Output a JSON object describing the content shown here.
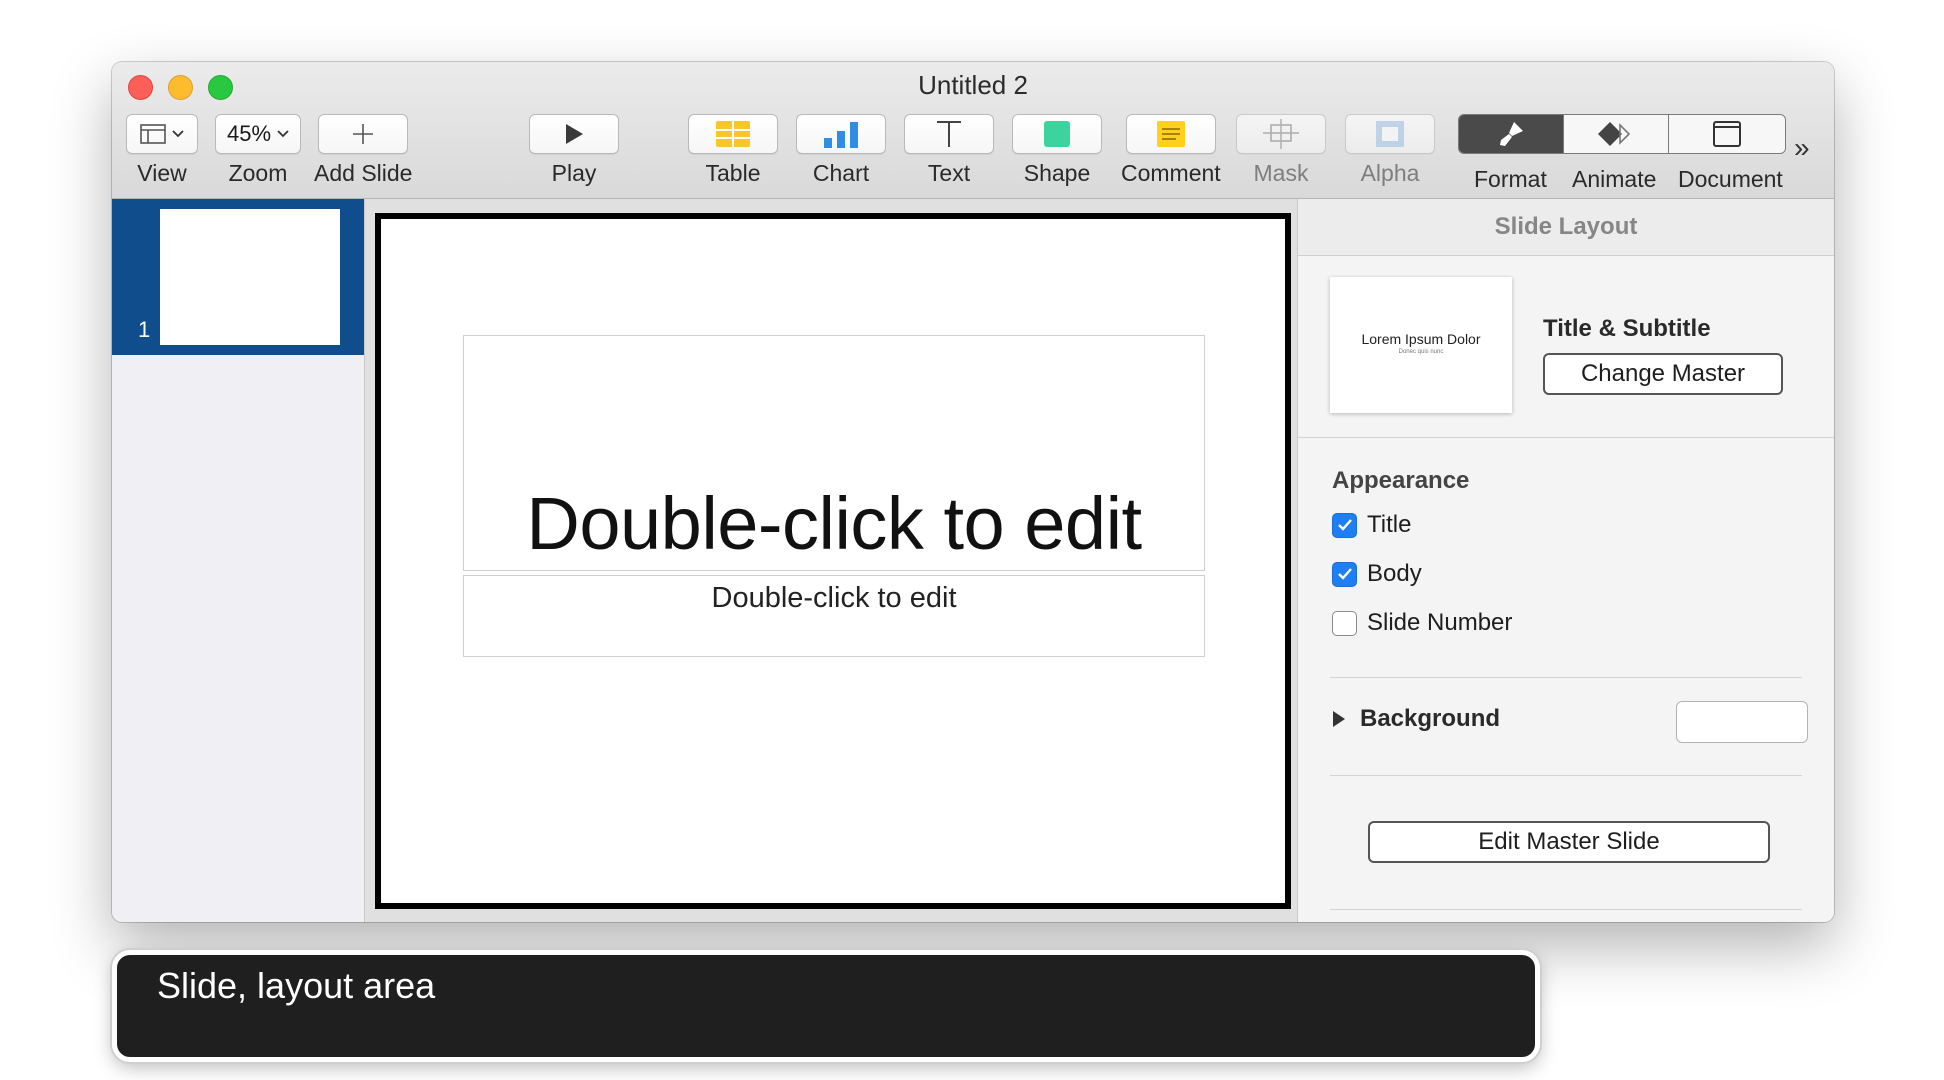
{
  "window": {
    "title": "Untitled 2"
  },
  "toolbar": {
    "view_label": "View",
    "zoom_value": "45%",
    "zoom_label": "Zoom",
    "add_slide_label": "Add Slide",
    "play_label": "Play",
    "table_label": "Table",
    "chart_label": "Chart",
    "text_label": "Text",
    "shape_label": "Shape",
    "comment_label": "Comment",
    "mask_label": "Mask",
    "alpha_label": "Alpha",
    "format_label": "Format",
    "animate_label": "Animate",
    "document_label": "Document",
    "overflow": "»"
  },
  "navigator": {
    "slides": [
      {
        "number": "1",
        "selected": true
      }
    ]
  },
  "slide": {
    "title_placeholder": "Double-click to edit",
    "body_placeholder": "Double-click to edit"
  },
  "inspector": {
    "header": "Slide Layout",
    "master_preview": {
      "title": "Lorem Ipsum Dolor",
      "subtitle": "Donec quis nunc"
    },
    "master_name": "Title & Subtitle",
    "change_master_label": "Change Master",
    "appearance_label": "Appearance",
    "options": [
      {
        "label": "Title",
        "checked": true
      },
      {
        "label": "Body",
        "checked": true
      },
      {
        "label": "Slide Number",
        "checked": false
      }
    ],
    "background_label": "Background",
    "edit_master_label": "Edit Master Slide"
  },
  "tooltip": {
    "text": "Slide, layout area"
  },
  "colors": {
    "selection_blue": "#0f4d8d",
    "checkbox_blue": "#1f7ef1",
    "format_active": "#4a4a4a",
    "tooltip_bg": "#1f1f1f"
  }
}
